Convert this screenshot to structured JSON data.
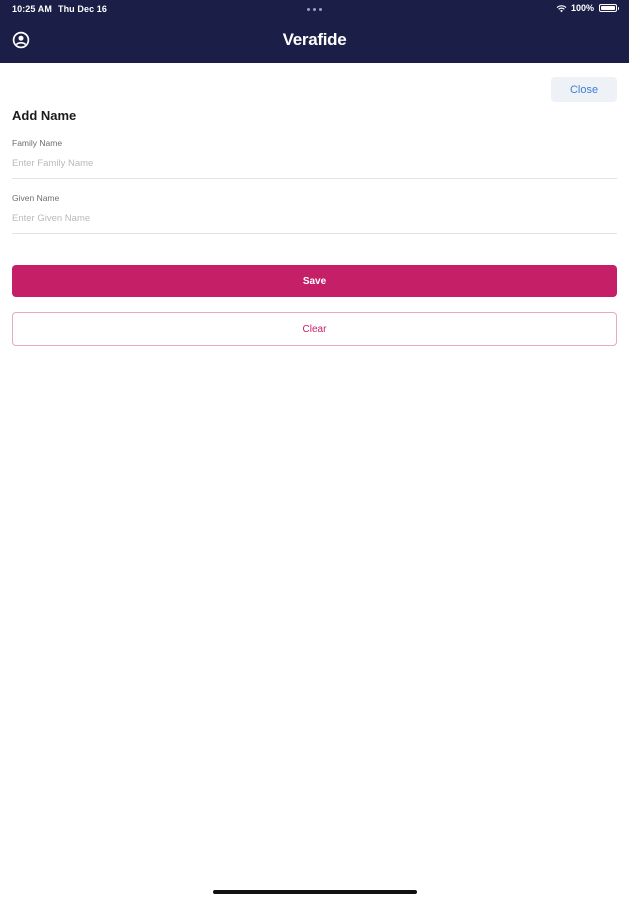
{
  "status_bar": {
    "time": "10:25 AM",
    "date": "Thu Dec 16",
    "battery": "100%"
  },
  "header": {
    "brand": "Verafide",
    "profile_icon": "account-circle-icon"
  },
  "form": {
    "close_label": "Close",
    "title": "Add Name",
    "family_name": {
      "label": "Family Name",
      "placeholder": "Enter Family Name",
      "value": ""
    },
    "given_name": {
      "label": "Given Name",
      "placeholder": "Enter Given Name",
      "value": ""
    },
    "save_label": "Save",
    "clear_label": "Clear"
  },
  "colors": {
    "header_bg": "#1b1f47",
    "accent": "#c51f68",
    "close_text": "#3d7fd6"
  }
}
